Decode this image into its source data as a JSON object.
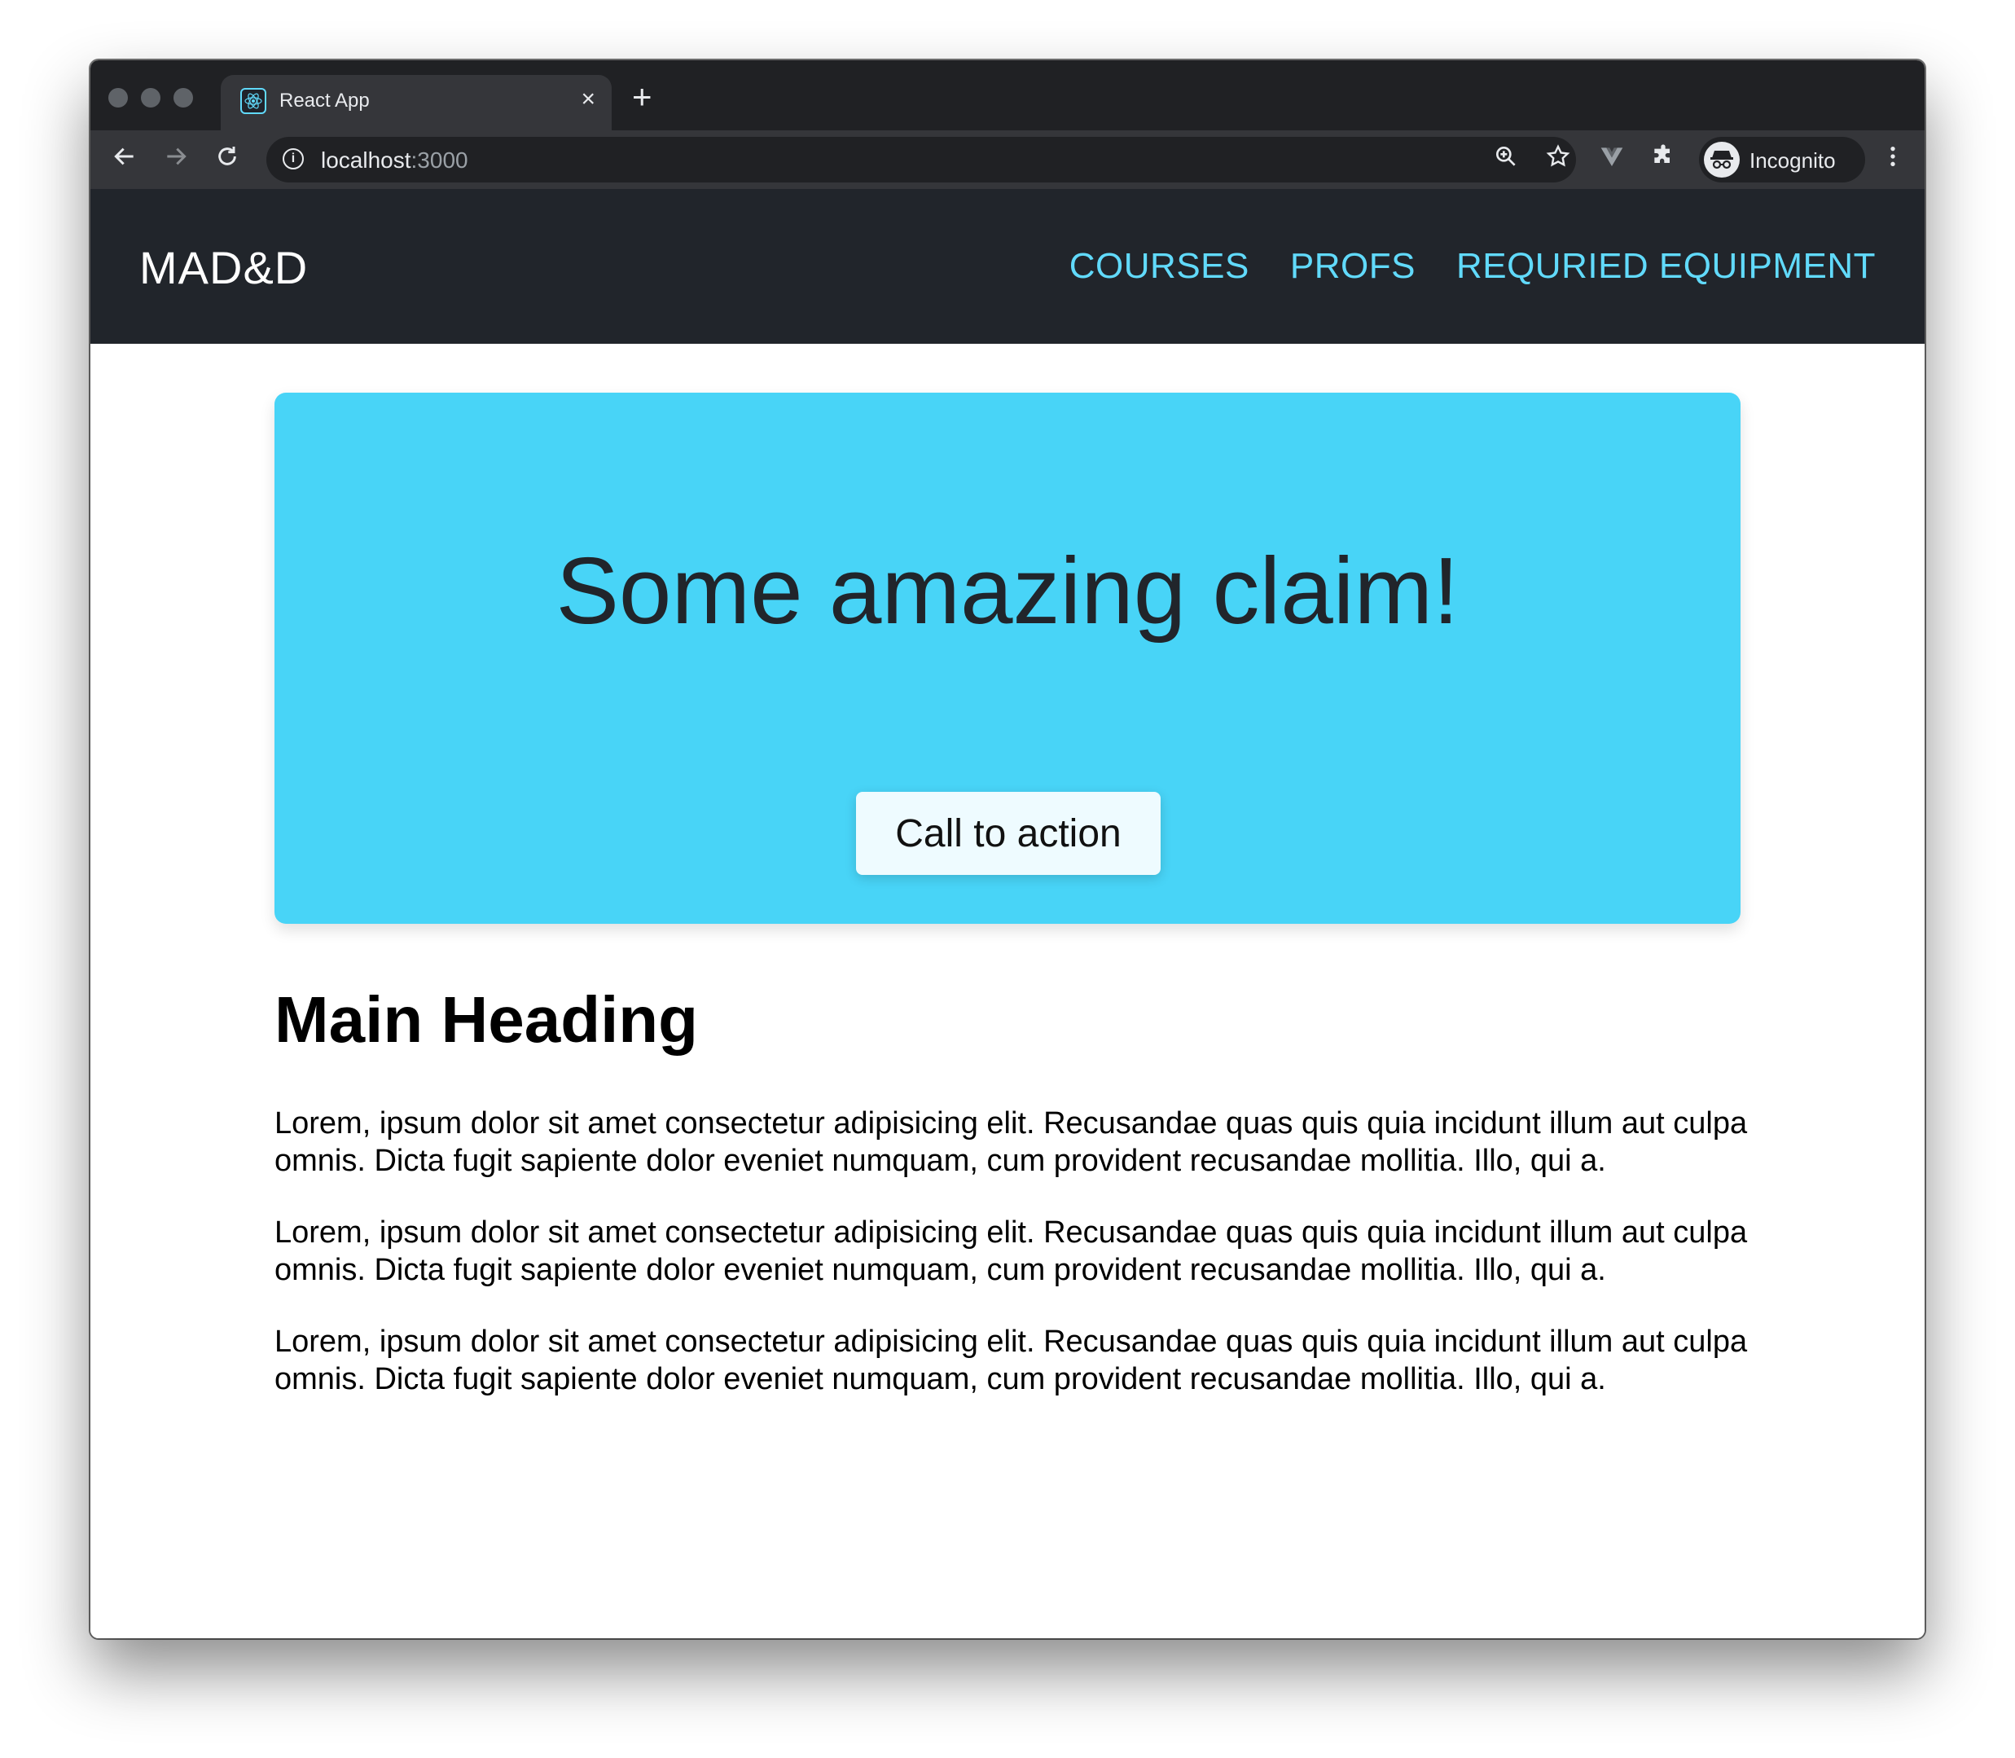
{
  "browser": {
    "tab_title": "React App",
    "tab_close": "×",
    "new_tab": "+",
    "url_host": "localhost",
    "url_port": ":3000",
    "profile_label": "Incognito"
  },
  "navbar": {
    "brand": "MAD&D",
    "links": [
      {
        "label": "COURSES"
      },
      {
        "label": "PROFS"
      },
      {
        "label": "REQURIED EQUIPMENT"
      }
    ]
  },
  "hero": {
    "claim": "Some amazing claim!",
    "cta_label": "Call to action"
  },
  "main": {
    "heading": "Main Heading",
    "paragraphs": [
      "Lorem, ipsum dolor sit amet consectetur adipisicing elit. Recusandae quas quis quia incidunt illum aut culpa omnis. Dicta fugit sapiente dolor eveniet numquam, cum provident recusandae mollitia. Illo, qui a.",
      "Lorem, ipsum dolor sit amet consectetur adipisicing elit. Recusandae quas quis quia incidunt illum aut culpa omnis. Dicta fugit sapiente dolor eveniet numquam, cum provident recusandae mollitia. Illo, qui a.",
      "Lorem, ipsum dolor sit amet consectetur adipisicing elit. Recusandae quas quis quia incidunt illum aut culpa omnis. Dicta fugit sapiente dolor eveniet numquam, cum provident recusandae mollitia. Illo, qui a."
    ]
  },
  "colors": {
    "navbar_bg": "#21252b",
    "accent": "#61dafb",
    "hero_bg": "#48d4f7"
  },
  "icons": {
    "back": "back-arrow-icon",
    "forward": "forward-arrow-icon",
    "reload": "reload-icon",
    "info": "info-icon",
    "zoom": "zoom-icon",
    "bookmark": "star-icon",
    "extension_v": "vue-devtools-icon",
    "extensions": "puzzle-icon",
    "menu": "kebab-menu-icon"
  }
}
